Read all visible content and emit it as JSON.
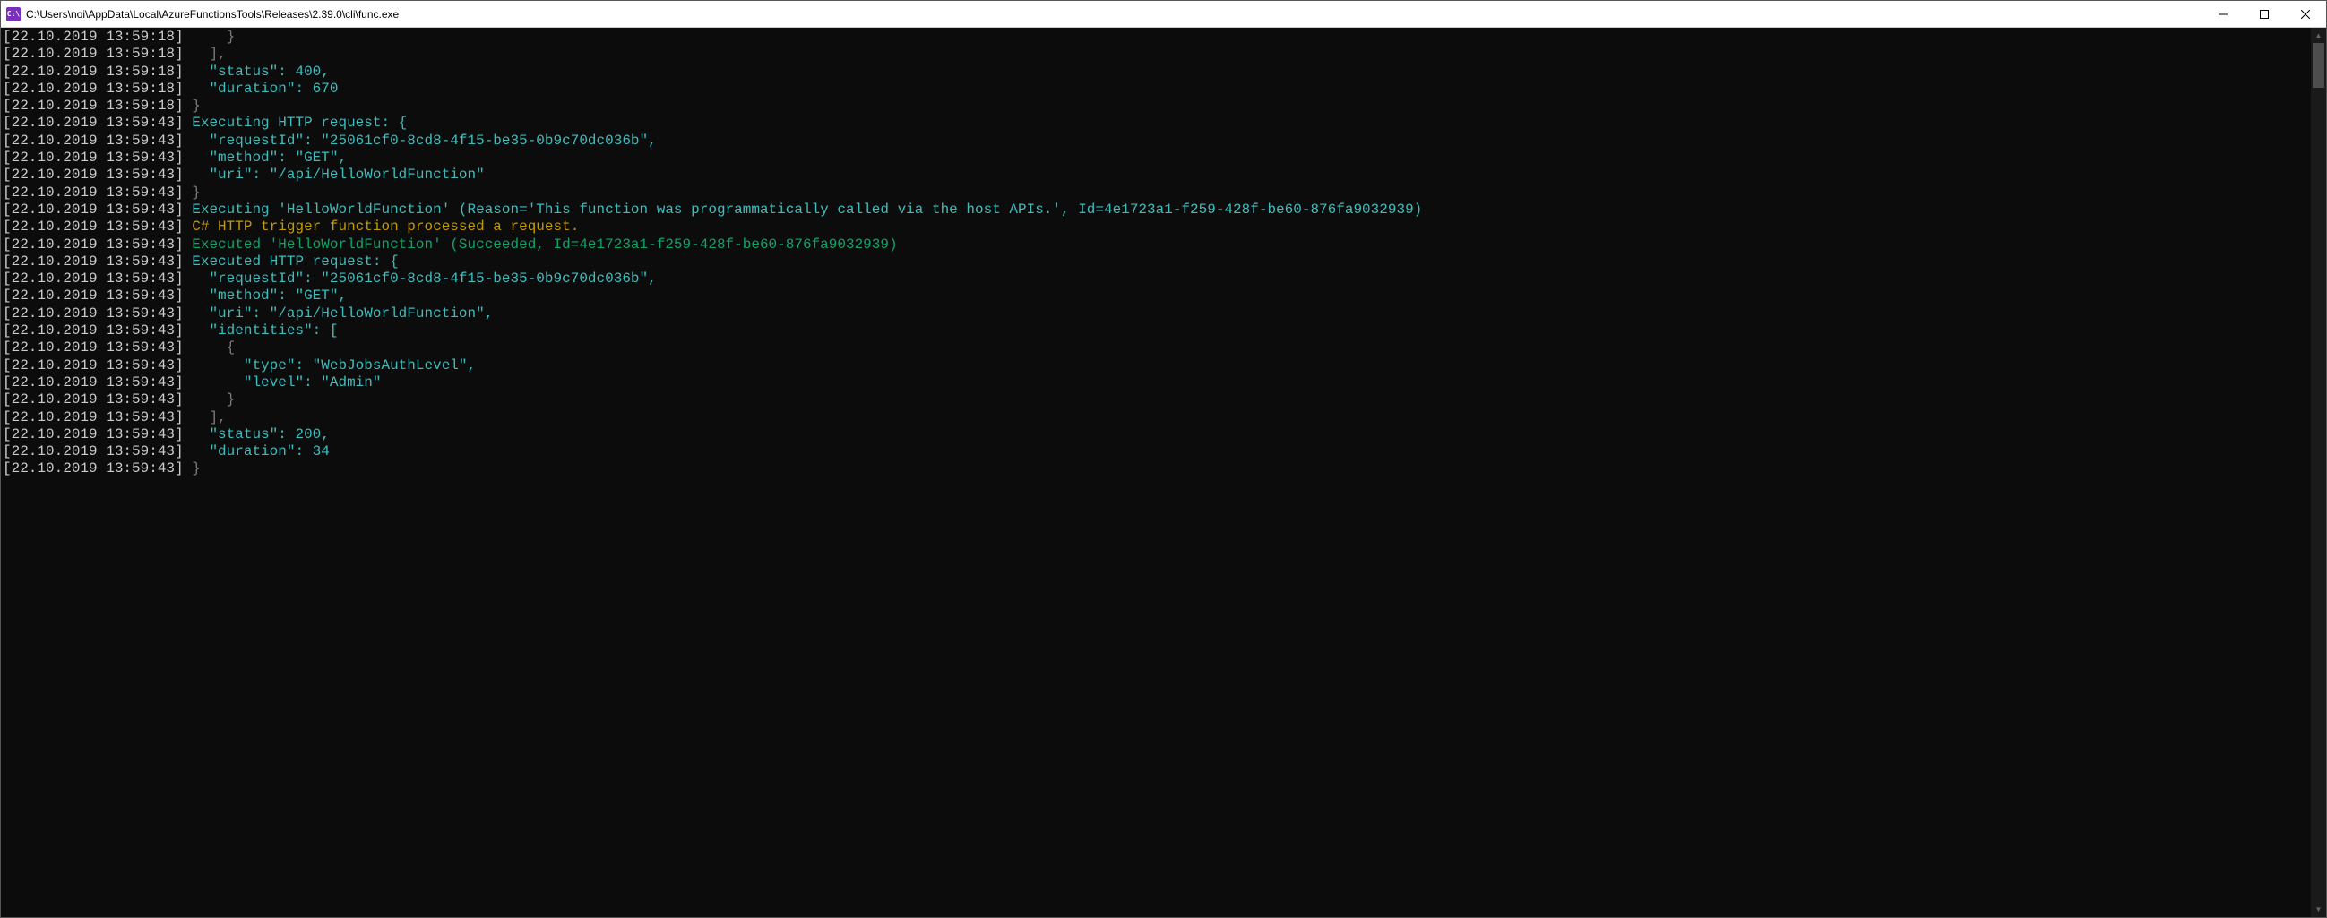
{
  "titlebar": {
    "icon_text": "C:\\",
    "title": "C:\\Users\\noi\\AppData\\Local\\AzureFunctionsTools\\Releases\\2.39.0\\cli\\func.exe"
  },
  "console": {
    "lines": [
      {
        "ts": "[22.10.2019 13:59:18]",
        "segs": [
          {
            "t": "     }",
            "c": "dim"
          }
        ]
      },
      {
        "ts": "[22.10.2019 13:59:18]",
        "segs": [
          {
            "t": "   ],",
            "c": "dim"
          }
        ]
      },
      {
        "ts": "[22.10.2019 13:59:18]",
        "segs": [
          {
            "t": "   \"status\": 400,",
            "c": "cyan"
          }
        ]
      },
      {
        "ts": "[22.10.2019 13:59:18]",
        "segs": [
          {
            "t": "   \"duration\": 670",
            "c": "cyan"
          }
        ]
      },
      {
        "ts": "[22.10.2019 13:59:18]",
        "segs": [
          {
            "t": " }",
            "c": "dim"
          }
        ]
      },
      {
        "ts": "[22.10.2019 13:59:43]",
        "segs": [
          {
            "t": " Executing HTTP request: {",
            "c": "cyan"
          }
        ]
      },
      {
        "ts": "[22.10.2019 13:59:43]",
        "segs": [
          {
            "t": "   \"requestId\": \"25061cf0-8cd8-4f15-be35-0b9c70dc036b\",",
            "c": "cyan"
          }
        ]
      },
      {
        "ts": "[22.10.2019 13:59:43]",
        "segs": [
          {
            "t": "   \"method\": \"GET\",",
            "c": "cyan"
          }
        ]
      },
      {
        "ts": "[22.10.2019 13:59:43]",
        "segs": [
          {
            "t": "   \"uri\": \"/api/HelloWorldFunction\"",
            "c": "cyan"
          }
        ]
      },
      {
        "ts": "[22.10.2019 13:59:43]",
        "segs": [
          {
            "t": " }",
            "c": "dim"
          }
        ]
      },
      {
        "ts": "[22.10.2019 13:59:43]",
        "segs": [
          {
            "t": " Executing 'HelloWorldFunction' (Reason='This function was programmatically called via the host APIs.', Id=4e1723a1-f259-428f-be60-876fa9032939)",
            "c": "cyan"
          }
        ]
      },
      {
        "ts": "[22.10.2019 13:59:43]",
        "segs": [
          {
            "t": " C# HTTP trigger function processed a request.",
            "c": "yellow"
          }
        ]
      },
      {
        "ts": "[22.10.2019 13:59:43]",
        "segs": [
          {
            "t": " Executed 'HelloWorldFunction' (Succeeded, Id=4e1723a1-f259-428f-be60-876fa9032939)",
            "c": "green"
          }
        ]
      },
      {
        "ts": "[22.10.2019 13:59:43]",
        "segs": [
          {
            "t": " Executed HTTP request: {",
            "c": "cyan"
          }
        ]
      },
      {
        "ts": "[22.10.2019 13:59:43]",
        "segs": [
          {
            "t": "   \"requestId\": \"25061cf0-8cd8-4f15-be35-0b9c70dc036b\",",
            "c": "cyan"
          }
        ]
      },
      {
        "ts": "[22.10.2019 13:59:43]",
        "segs": [
          {
            "t": "   \"method\": \"GET\",",
            "c": "cyan"
          }
        ]
      },
      {
        "ts": "[22.10.2019 13:59:43]",
        "segs": [
          {
            "t": "   \"uri\": \"/api/HelloWorldFunction\",",
            "c": "cyan"
          }
        ]
      },
      {
        "ts": "[22.10.2019 13:59:43]",
        "segs": [
          {
            "t": "   \"identities\": [",
            "c": "cyan"
          }
        ]
      },
      {
        "ts": "[22.10.2019 13:59:43]",
        "segs": [
          {
            "t": "     {",
            "c": "dim"
          }
        ]
      },
      {
        "ts": "[22.10.2019 13:59:43]",
        "segs": [
          {
            "t": "       \"type\": \"WebJobsAuthLevel\",",
            "c": "cyan"
          }
        ]
      },
      {
        "ts": "[22.10.2019 13:59:43]",
        "segs": [
          {
            "t": "       \"level\": \"Admin\"",
            "c": "cyan"
          }
        ]
      },
      {
        "ts": "[22.10.2019 13:59:43]",
        "segs": [
          {
            "t": "     }",
            "c": "dim"
          }
        ]
      },
      {
        "ts": "[22.10.2019 13:59:43]",
        "segs": [
          {
            "t": "   ],",
            "c": "dim"
          }
        ]
      },
      {
        "ts": "[22.10.2019 13:59:43]",
        "segs": [
          {
            "t": "   \"status\": 200,",
            "c": "cyan"
          }
        ]
      },
      {
        "ts": "[22.10.2019 13:59:43]",
        "segs": [
          {
            "t": "   \"duration\": 34",
            "c": "cyan"
          }
        ]
      },
      {
        "ts": "[22.10.2019 13:59:43]",
        "segs": [
          {
            "t": " }",
            "c": "dim"
          }
        ]
      }
    ]
  }
}
